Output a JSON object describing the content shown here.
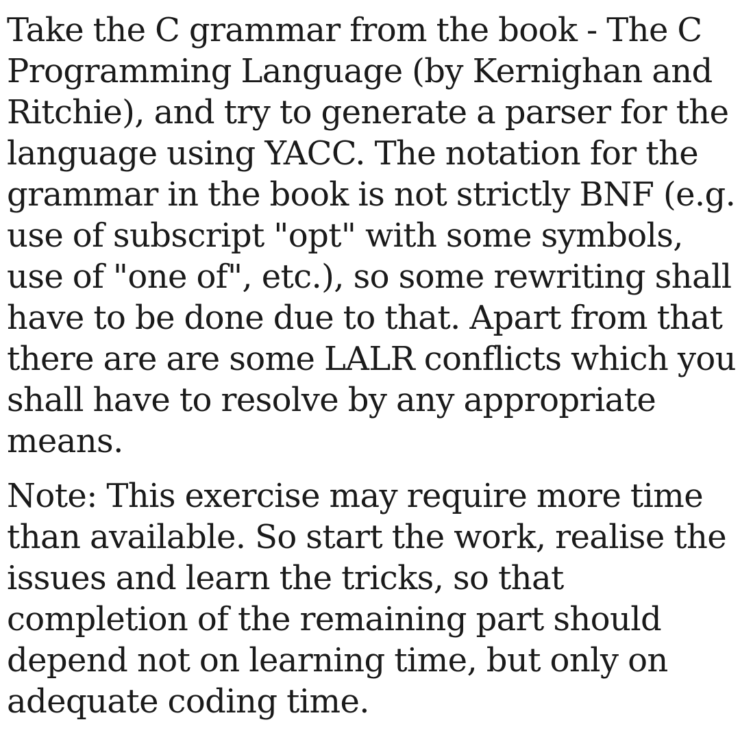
{
  "document": {
    "paragraphs": [
      "Take the C grammar from the book - The C Programming Language (by Kernighan and Ritchie), and try to generate a parser for the language using YACC. The notation for the grammar in the book is not strictly BNF (e.g. use of subscript \"opt\" with some symbols, use of \"one of\", etc.), so some rewriting shall have to be done due to that. Apart from that there are are some LALR conflicts which you shall have to resolve by any appropriate means.",
      "Note: This exercise may require more time than available. So start the work, realise the issues and learn the tricks, so that completion of the remaining part should depend not on learning time, but only on adequate coding time."
    ]
  }
}
